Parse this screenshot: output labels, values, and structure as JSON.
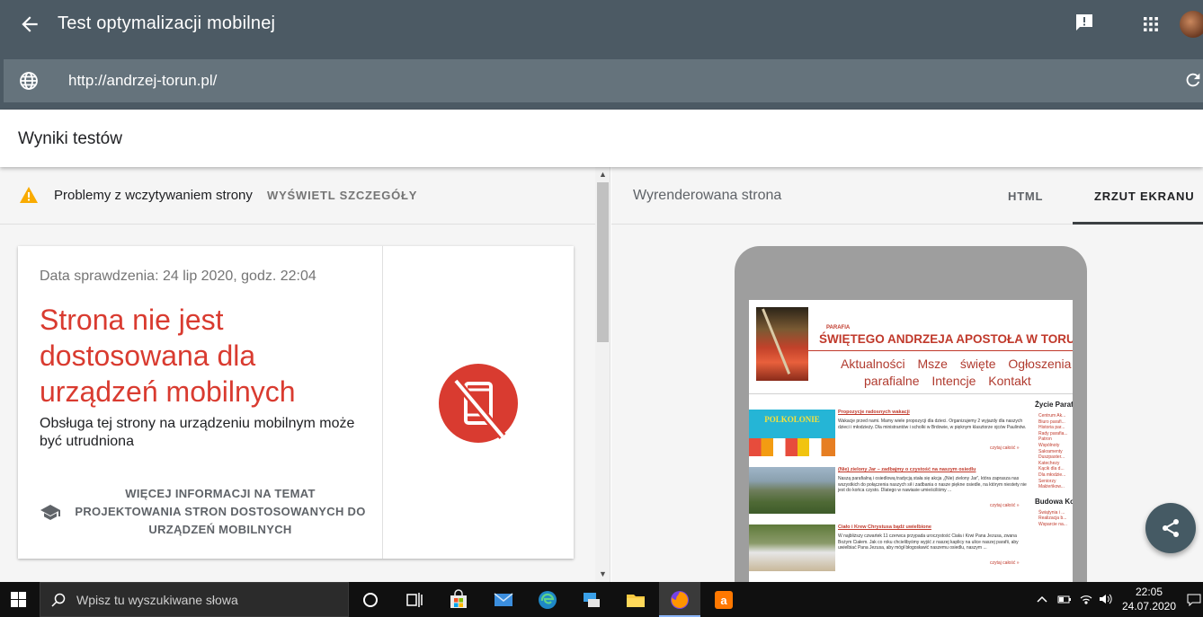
{
  "app": {
    "title": "Test optymalizacji mobilnej",
    "url": "http://andrzej-torun.pl/"
  },
  "results": {
    "heading": "Wyniki testów",
    "warning_text": "Problemy z wczytywaniem strony",
    "warning_link": "WYŚWIETL SZCZEGÓŁY"
  },
  "card": {
    "date": "Data sprawdzenia: 24 lip 2020, godz. 22:04",
    "verdict": "Strona nie jest dostosowana dla urządzeń mobilnych",
    "description": "Obsługa tej strony na urządzeniu mobilnym może być utrudniona",
    "more_link": "WIĘCEJ INFORMACJI NA TEMAT PROJEKTOWANIA STRON DOSTOSOWANYCH DO URZĄDZEŃ MOBILNYCH"
  },
  "preview": {
    "rendered_label": "Wyrenderowana strona",
    "tab_html": "HTML",
    "tab_screenshot": "ZRZUT EKRANU",
    "active_tab": "ZRZUT EKRANU"
  },
  "site": {
    "parafia": "PARAFIA",
    "parish_name": "ŚWIĘTEGO ANDRZEJA APOSTOŁA W TORUNIU",
    "nav_line1": "Aktualności Msze święte Ogłoszenia",
    "nav_line2": "parafialne Intencje Kontakt",
    "posts": [
      {
        "title": "Propozycje radosnych wakacji",
        "body": "Wakacje przed nami. Mamy wiele propozycji dla dzieci. Organizujemy 2 wyjazdy dla naszych dzieci i młodzieży. Dla ministrantów i scholki w Brdowie, w pięknym klasztorze ojców Paulinów.",
        "more": "czytaj całość »",
        "thumb_text": "POLKOLONIE"
      },
      {
        "title": "(Nie) zielony Jar – zadbajmy o czystość na naszym osiedlu",
        "body": "Naszą parafialną i osiedlową tradycją stała się akcja „(Nie) zielony Jar”, która zaprasza nas wszystkich do połączenia naszych sił i zadbania o nasze piękne osiedle, na którym niestety nie jest do końca czysto. Dlatego w nawiasie umieściliśmy ...",
        "more": "czytaj całość »"
      },
      {
        "title": "Ciało i Krew Chrystusa bądź uwielbione",
        "body": "W najbliższy czwartek 11 czerwca przypada uroczystość Ciała i Krwi Pana Jezusa, zwana Bożym Ciałem. Jak co roku chcielibyśmy wyjść z naszej kaplicy na ulice naszej parafii, aby uwielbiać Pana Jezusa, aby mógł błogosławić naszemu osiedlu, naszym ...",
        "more": "czytaj całość »"
      }
    ],
    "sidebar_heading1": "Życie Parafii",
    "sidebar_items1": [
      "Centrum Ak...",
      "Biuro parafi...",
      "Historia par...",
      "Rady parafia...",
      "Patron",
      "Wspólnoty",
      "Sakramenty",
      "Duszpaster...",
      "Katechezy",
      "Kącik dla d...",
      "Dla młodzie...",
      "Seniorzy",
      "Małżeńkow..."
    ],
    "sidebar_heading2": "Budowa Ko...",
    "sidebar_items2": [
      "Świątynia i ...",
      "Realizacja b...",
      "Wsparcie na..."
    ]
  },
  "taskbar": {
    "search_placeholder": "Wpisz tu wyszukiwane słowa",
    "time": "22:05",
    "date": "24.07.2020"
  },
  "colors": {
    "appbar": "#4c5a64",
    "error_red": "#d93b30",
    "warning_yellow": "#f9ab00",
    "fab": "#455a64"
  }
}
